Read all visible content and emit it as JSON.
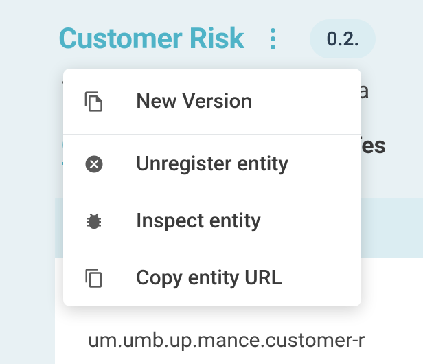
{
  "header": {
    "title": "Customer Risk",
    "version_pill": "0.2."
  },
  "background": {
    "line1_left": "V",
    "line1_right": "re Ca",
    "line2_left": "O",
    "line2_right": "d Tes",
    "line4": "um.umb.up.mance.customer-r"
  },
  "menu": {
    "items": [
      {
        "label": "New Version",
        "icon": "copy-file-icon"
      },
      {
        "label": "Unregister entity",
        "icon": "close-circle-icon"
      },
      {
        "label": "Inspect entity",
        "icon": "bug-icon"
      },
      {
        "label": "Copy entity URL",
        "icon": "copy-icon"
      }
    ]
  }
}
